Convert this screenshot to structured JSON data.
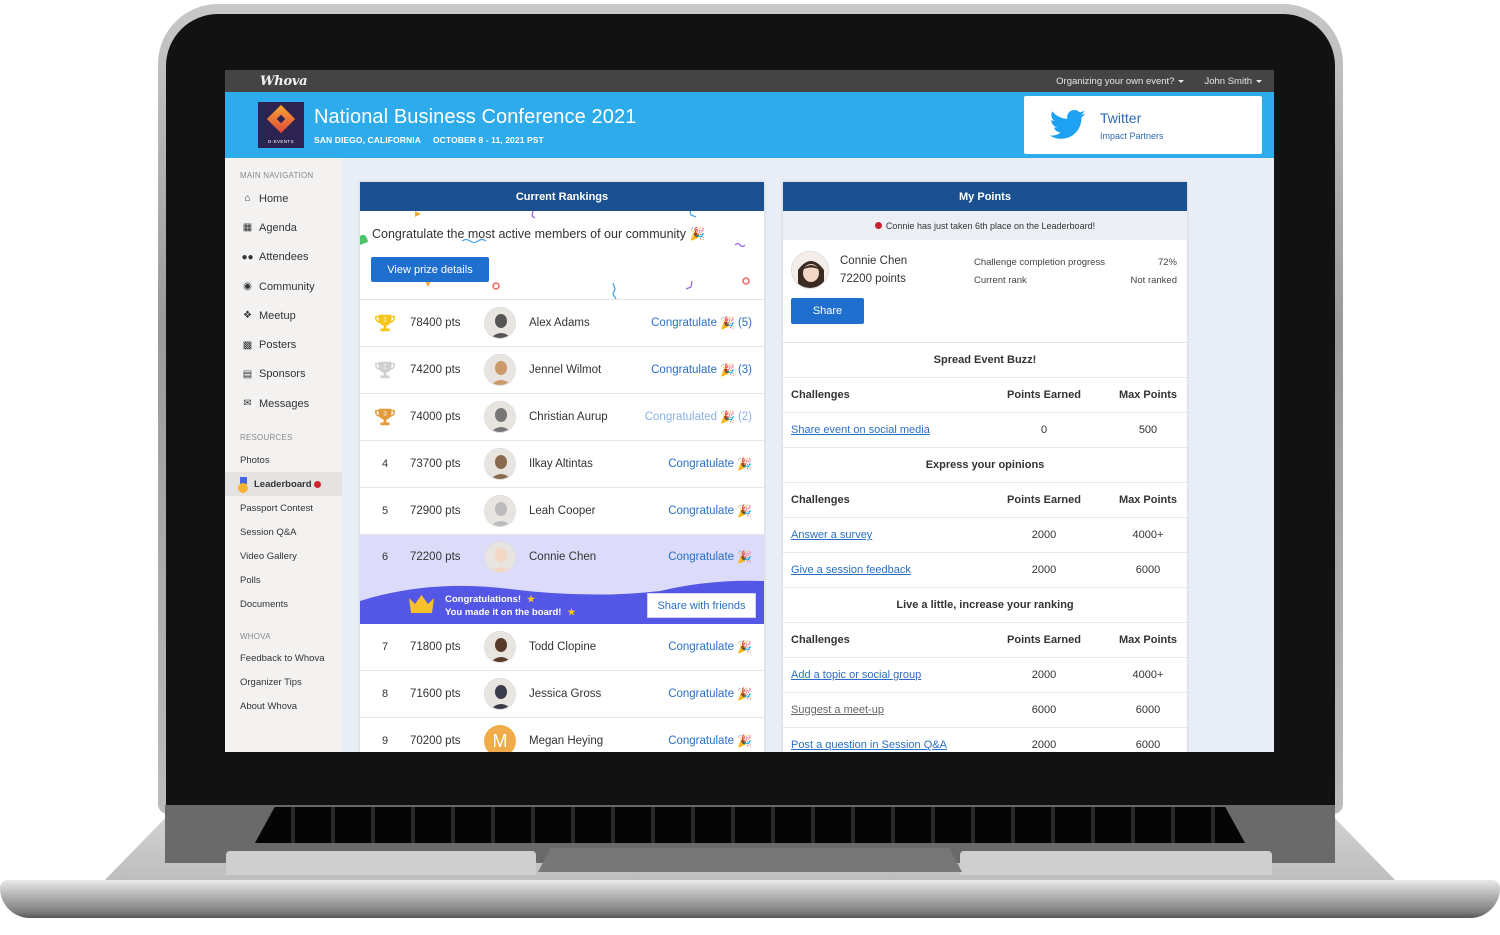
{
  "topbar": {
    "brand": "Whova",
    "organize_menu": "Organizing your own event?",
    "user_menu": "John Smith"
  },
  "event": {
    "logo_text": "D-EVENTS",
    "title": "National Business Conference 2021",
    "location": "SAN DIEGO, CALIFORNIA",
    "dates": "OCTOBER 8 - 11, 2021 PST"
  },
  "sponsor": {
    "name": "Twitter",
    "subtitle": "Impact Partners",
    "icon": "twitter-bird-icon"
  },
  "sidebar": {
    "main_heading": "MAIN NAVIGATION",
    "main_items": [
      {
        "label": "Home",
        "icon": "home-icon"
      },
      {
        "label": "Agenda",
        "icon": "calendar-icon"
      },
      {
        "label": "Attendees",
        "icon": "users-icon"
      },
      {
        "label": "Community",
        "icon": "comments-icon"
      },
      {
        "label": "Meetup",
        "icon": "handshake-icon"
      },
      {
        "label": "Posters",
        "icon": "building-icon"
      },
      {
        "label": "Sponsors",
        "icon": "building-icon"
      },
      {
        "label": "Messages",
        "icon": "envelope-icon"
      }
    ],
    "resources_heading": "RESOURCES",
    "resource_items": [
      {
        "label": "Photos"
      },
      {
        "label": "Leaderboard",
        "active": true,
        "badge": "new"
      },
      {
        "label": "Passport Contest"
      },
      {
        "label": "Session Q&A"
      },
      {
        "label": "Video Gallery"
      },
      {
        "label": "Polls"
      },
      {
        "label": "Documents"
      }
    ],
    "whova_heading": "WHOVA",
    "whova_items": [
      {
        "label": "Feedback to Whova"
      },
      {
        "label": "Organizer Tips"
      },
      {
        "label": "About Whova"
      }
    ]
  },
  "rankings": {
    "title": "Current Rankings",
    "intro": "Congratulate the most active members of our community",
    "prize_button": "View prize details",
    "rows": [
      {
        "rank": "1",
        "trophy": "gold",
        "points": "78400 pts",
        "name": "Alex Adams",
        "action": "Congratulate",
        "count": "(5)",
        "done": false
      },
      {
        "rank": "2",
        "trophy": "silver",
        "points": "74200 pts",
        "name": "Jennel Wilmot",
        "action": "Congratulate",
        "count": "(3)",
        "done": false
      },
      {
        "rank": "3",
        "trophy": "bronze",
        "points": "74000 pts",
        "name": "Christian Aurup",
        "action": "Congratulated",
        "count": "(2)",
        "done": true
      },
      {
        "rank": "4",
        "points": "73700 pts",
        "name": "Ilkay Altintas",
        "action": "Congratulate",
        "count": "",
        "done": false
      },
      {
        "rank": "5",
        "points": "72900 pts",
        "name": "Leah Cooper",
        "action": "Congratulate",
        "count": "",
        "done": false
      },
      {
        "rank": "6",
        "points": "72200 pts",
        "name": "Connie Chen",
        "action": "Congratulate",
        "count": "",
        "done": false,
        "me": true
      },
      {
        "rank": "7",
        "points": "71800 pts",
        "name": "Todd Clopine",
        "action": "Congratulate",
        "count": "",
        "done": false
      },
      {
        "rank": "8",
        "points": "71600 pts",
        "name": "Jessica Gross",
        "action": "Congratulate",
        "count": "",
        "done": false
      },
      {
        "rank": "9",
        "points": "70200 pts",
        "name": "Megan Heying",
        "action": "Congratulate",
        "count": "",
        "done": false,
        "initial": "M"
      }
    ],
    "banner": {
      "line1": "Congratulations!",
      "line2": "You made it on the board!",
      "share_button": "Share with friends"
    }
  },
  "my_points": {
    "title": "My Points",
    "notice": "Connie has just taken 6th place on the Leaderboard!",
    "name": "Connie Chen",
    "points": "72200 points",
    "progress_label": "Challenge completion progress",
    "progress_value": "72%",
    "rank_label": "Current rank",
    "rank_value": "Not ranked",
    "share_button": "Share",
    "columns": [
      "Challenges",
      "Points Earned",
      "Max Points"
    ],
    "sections": [
      {
        "title": "Spread Event Buzz!",
        "challenges": [
          {
            "name": "Share event on social media",
            "earned": "0",
            "max": "500",
            "done": false
          }
        ]
      },
      {
        "title": "Express your opinions",
        "challenges": [
          {
            "name": "Answer a survey",
            "earned": "2000",
            "max": "4000+",
            "done": false
          },
          {
            "name": "Give a session feedback",
            "earned": "2000",
            "max": "6000",
            "done": false
          }
        ]
      },
      {
        "title": "Live a little, increase your ranking",
        "challenges": [
          {
            "name": "Add a topic or social group",
            "earned": "2000",
            "max": "4000+",
            "done": false
          },
          {
            "name": "Suggest a meet-up",
            "earned": "6000",
            "max": "6000",
            "done": true
          },
          {
            "name": "Post a question in Session Q&A",
            "earned": "2000",
            "max": "6000",
            "done": false
          }
        ]
      }
    ]
  },
  "colors": {
    "banner_blue": "#2eabea",
    "panel_header": "#1a508f",
    "button_blue": "#1f6fcf",
    "link_blue": "#2a6fc4",
    "highlight_row": "#dcdcfa",
    "wave_purple": "#5457e6",
    "alert_red": "#d0232a"
  }
}
